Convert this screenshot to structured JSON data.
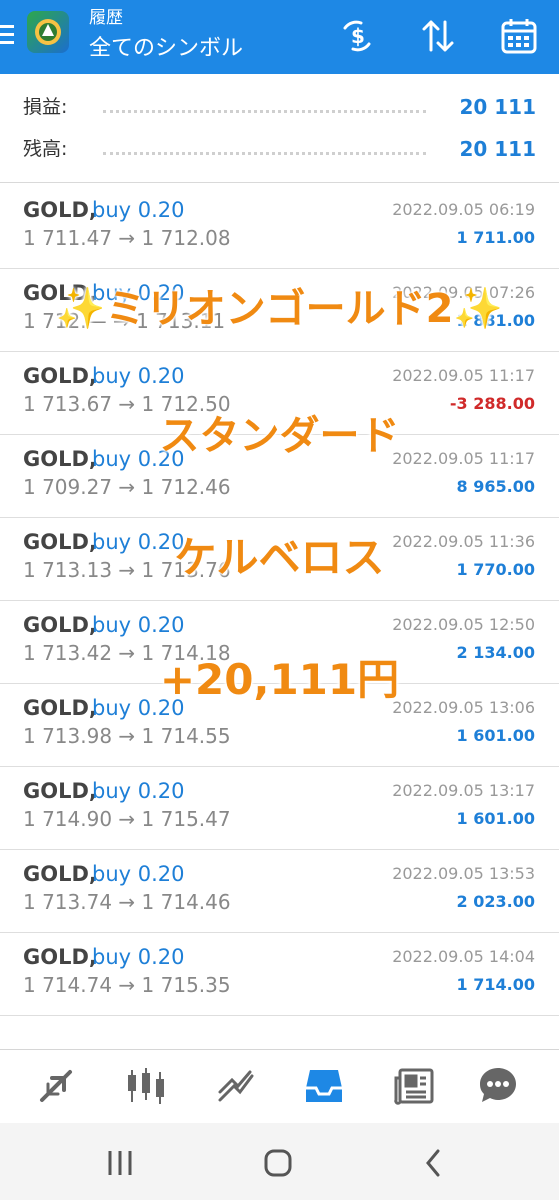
{
  "header": {
    "subtitle": "履歴",
    "title": "全てのシンボル",
    "icons": [
      "menu-icon",
      "metatrader-logo-icon",
      "dollar-exchange-icon",
      "sort-icon",
      "calendar-icon"
    ]
  },
  "summary": {
    "profit_label": "損益:",
    "profit_value": "20 111",
    "balance_label": "残高:",
    "balance_value": "20 111"
  },
  "trades": [
    {
      "symbol": "GOLD,",
      "side": "buy 0.20",
      "prices": "1 711.47 → 1 712.08",
      "time": "2022.09.05 06:19",
      "profit": "1 711.00"
    },
    {
      "symbol": "GOLD,",
      "side": "buy 0.20",
      "prices": "1 712.— → 1 713.11",
      "time": "2022.09.05 07:26",
      "profit": "1 881.00"
    },
    {
      "symbol": "GOLD,",
      "side": "buy 0.20",
      "prices": "1 713.67 → 1 712.50",
      "time": "2022.09.05 11:17",
      "profit": "-3 288.00"
    },
    {
      "symbol": "GOLD,",
      "side": "buy 0.20",
      "prices": "1 709.27 → 1 712.46",
      "time": "2022.09.05 11:17",
      "profit": "8 965.00"
    },
    {
      "symbol": "GOLD,",
      "side": "buy 0.20",
      "prices": "1 713.13 → 1 713.76",
      "time": "2022.09.05 11:36",
      "profit": "1 770.00"
    },
    {
      "symbol": "GOLD,",
      "side": "buy 0.20",
      "prices": "1 713.42 → 1 714.18",
      "time": "2022.09.05 12:50",
      "profit": "2 134.00"
    },
    {
      "symbol": "GOLD,",
      "side": "buy 0.20",
      "prices": "1 713.98 → 1 714.55",
      "time": "2022.09.05 13:06",
      "profit": "1 601.00"
    },
    {
      "symbol": "GOLD,",
      "side": "buy 0.20",
      "prices": "1 714.90 → 1 715.47",
      "time": "2022.09.05 13:17",
      "profit": "1 601.00"
    },
    {
      "symbol": "GOLD,",
      "side": "buy 0.20",
      "prices": "1 713.74 → 1 714.46",
      "time": "2022.09.05 13:53",
      "profit": "2 023.00"
    },
    {
      "symbol": "GOLD,",
      "side": "buy 0.20",
      "prices": "1 714.74 → 1 715.35",
      "time": "2022.09.05 14:04",
      "profit": "1 714.00"
    }
  ],
  "overlay": {
    "line1_sparkle_left": "✨",
    "line1": "ミリオンゴールド2",
    "line1_sparkle_right": "✨",
    "line2": "スタンダード",
    "line3": "ケルベロス",
    "line4": "+20,111円"
  },
  "bottom_nav": [
    "quotes-arrows-icon",
    "chart-candles-icon",
    "trade-icon",
    "history-inbox-icon",
    "news-icon",
    "chat-icon"
  ],
  "system_nav": [
    "recent-apps-icon",
    "home-icon",
    "back-icon"
  ],
  "colors": {
    "accent": "#1e88e5",
    "profit_positive": "#1e7fd7",
    "profit_negative": "#d02a2a",
    "overlay_text": "#f08a12"
  }
}
